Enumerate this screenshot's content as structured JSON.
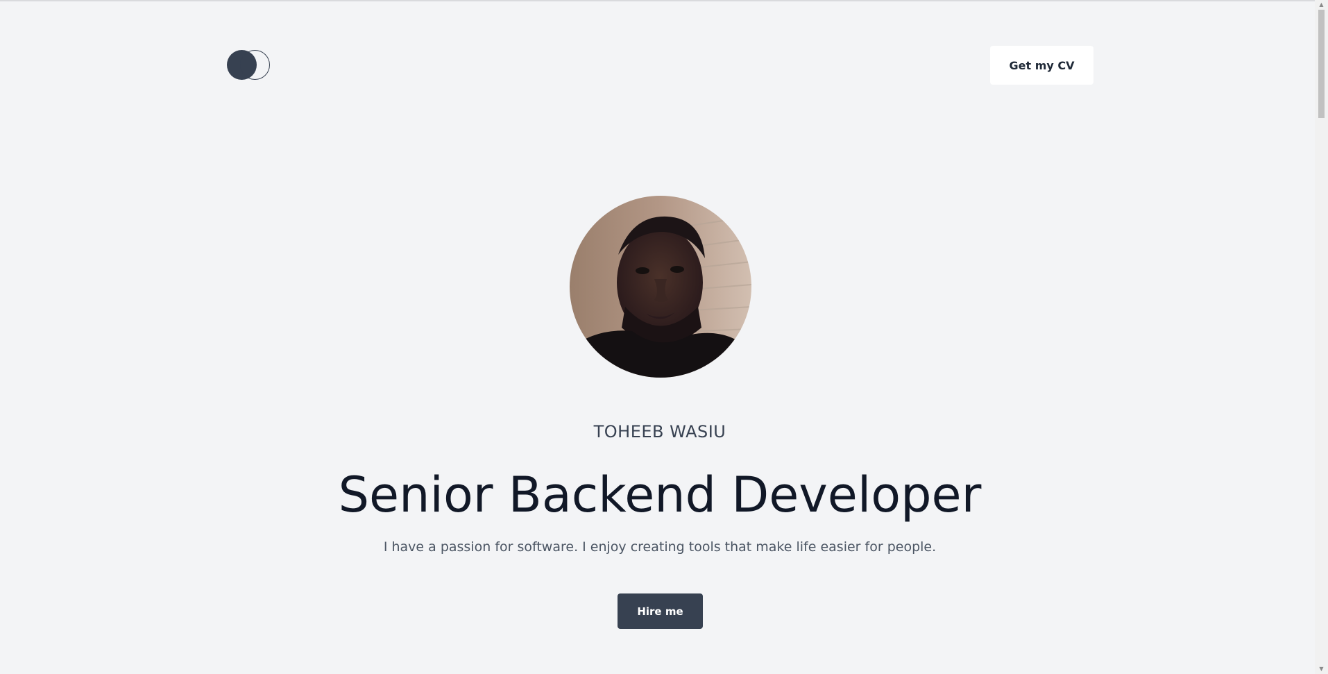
{
  "header": {
    "logo_icon": "overlapping-circles-logo",
    "cv_button_label": "Get my CV"
  },
  "hero": {
    "avatar_alt": "profile photo",
    "name": "TOHEEB WASIU",
    "title": "Senior Backend Developer",
    "tagline": "I have a passion for software. I enjoy creating tools that make life easier for people.",
    "hire_button_label": "Hire me"
  },
  "colors": {
    "background": "#f3f4f6",
    "primary": "#374151",
    "heading": "#111827",
    "muted": "#4b5563"
  }
}
